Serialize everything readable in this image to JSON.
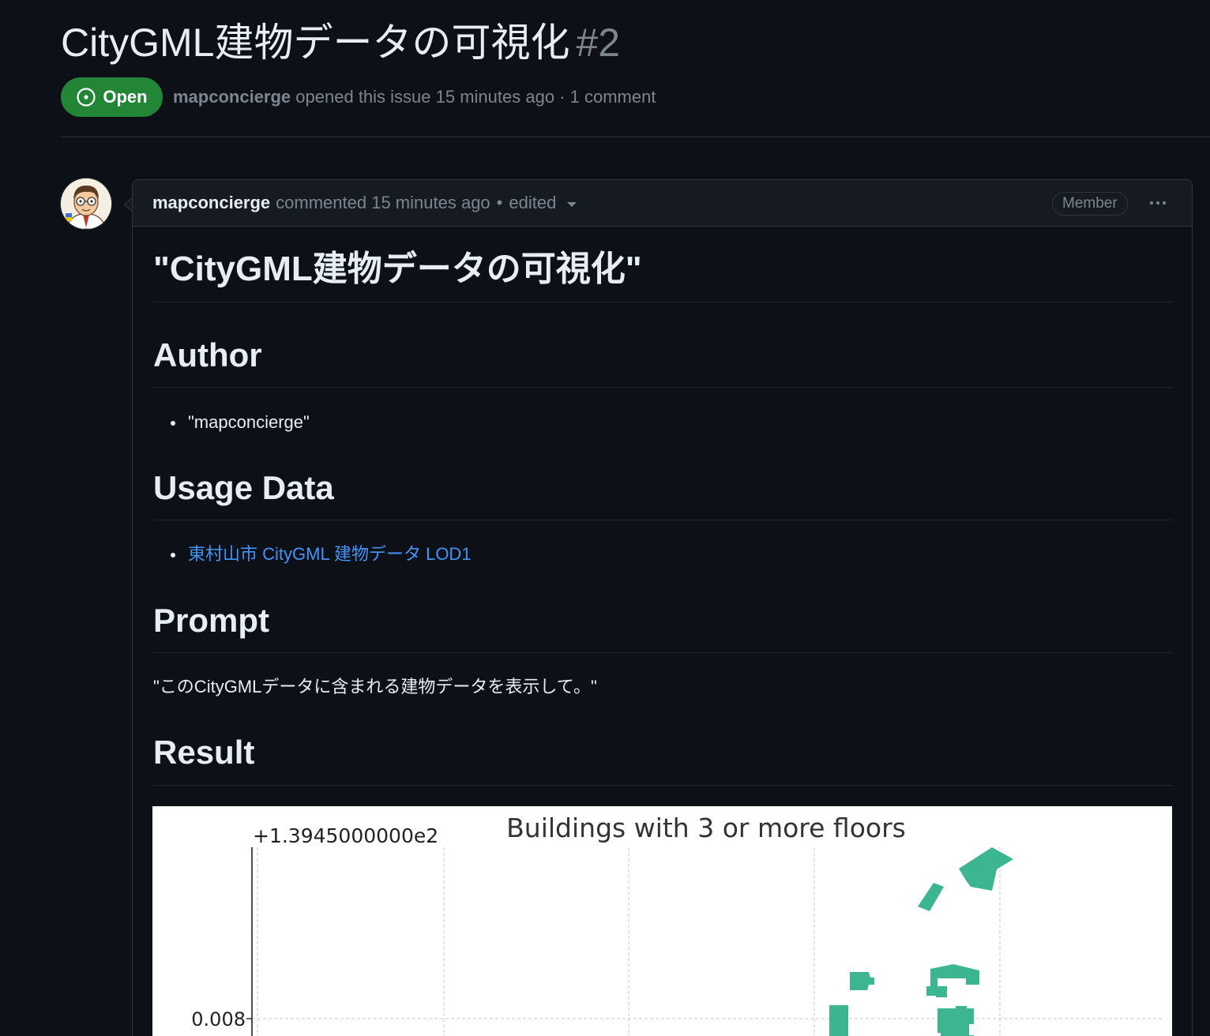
{
  "issue": {
    "title": "CityGML建物データの可視化",
    "number": "#2",
    "state": "Open",
    "author": "mapconcierge",
    "meta_text": "opened this issue 15 minutes ago · 1 comment"
  },
  "comment": {
    "author": "mapconcierge",
    "action": "commented 15 minutes ago",
    "separator": "•",
    "edited": "edited",
    "role": "Member"
  },
  "body": {
    "title": "\"CityGML建物データの可視化\"",
    "sections": {
      "author_heading": "Author",
      "author_value": "\"mapconcierge\"",
      "usage_heading": "Usage Data",
      "usage_link": "東村山市 CityGML 建物データ LOD1",
      "prompt_heading": "Prompt",
      "prompt_text": "\"このCityGMLデータに含まれる建物データを表示して。\"",
      "result_heading": "Result"
    }
  },
  "chart_data": {
    "type": "scatter",
    "title": "Buildings with 3 or more floors",
    "y_offset_label": "+1.3945000000e2",
    "y_tick_labels": [
      "0.008"
    ],
    "grid": true,
    "fill_color": "#3cb591"
  }
}
